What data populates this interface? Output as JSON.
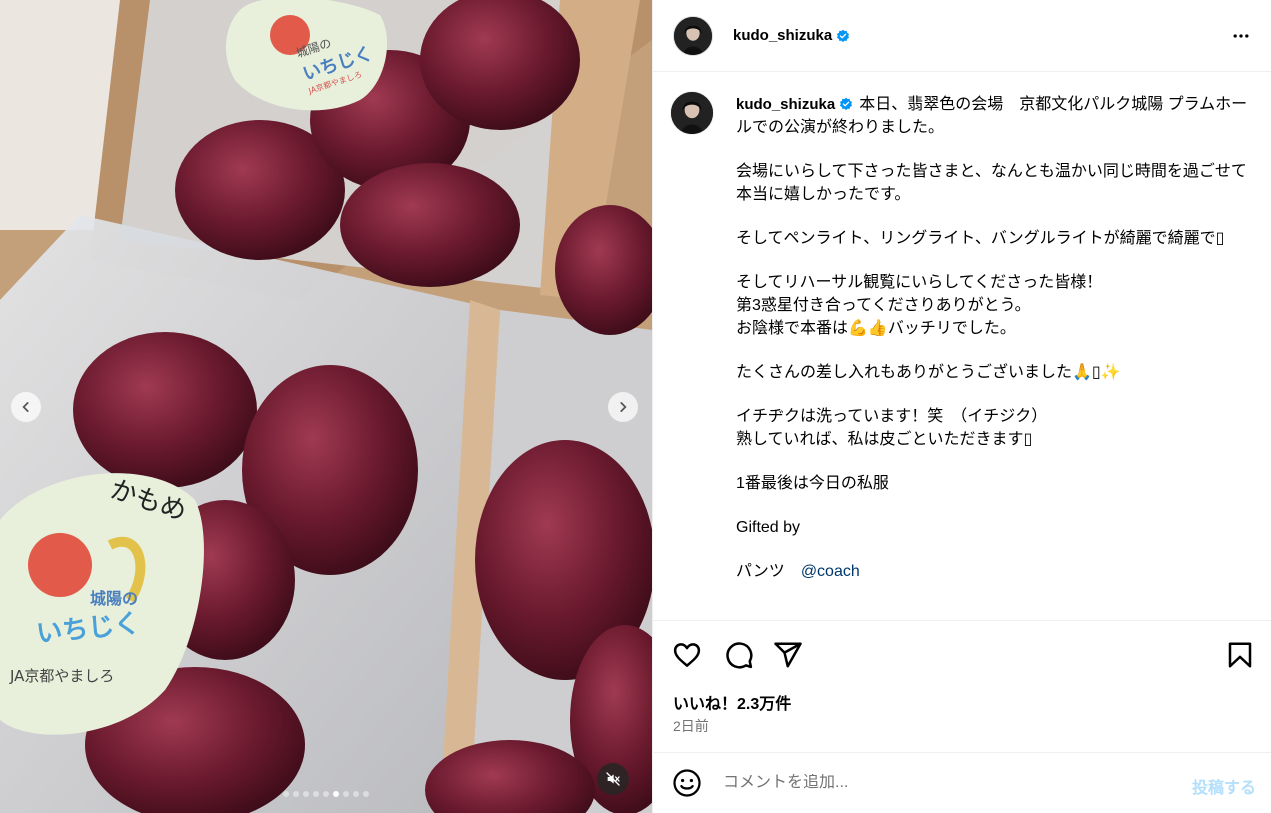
{
  "post": {
    "username": "kudo_shizuka",
    "verified_icon": "verified-badge-icon",
    "more_icon": "more-options-icon"
  },
  "media": {
    "label_top": {
      "line1": "城陽の",
      "line2": "いちじく",
      "line3": "JA京都やましろ"
    },
    "label_bottom": {
      "handwritten": "かもめ",
      "line1": "城陽の",
      "line2": "いちじく",
      "line3": "JA京都やましろ"
    },
    "slide_count": 9,
    "active_slide": 6,
    "colors": {
      "fig": "#6b1a2e",
      "box": "#c9a57d",
      "tray": "#d9dde3",
      "label": "#e8f0dc"
    }
  },
  "caption": {
    "lines": [
      {
        "text": "本日、翡翠色の会場　京都文化パルク城陽 プラムホールでの公演が終わりました。"
      },
      {
        "text": "会場にいらして下さった皆さまと、なんとも温かい同じ時間を過ごせて本当に嬉しかったです。"
      },
      {
        "text": "そしてペンライト、リングライト、バングルライトが綺麗で綺麗で▯"
      },
      {
        "text": "そしてリハーサル観覧にいらしてくださった皆様！"
      },
      {
        "text": "第3惑星付き合ってくださりありがとう。"
      },
      {
        "text": "お陰様で本番は💪👍バッチリでした。"
      },
      {
        "text": "たくさんの差し入れもありがとうございました🙏▯✨"
      },
      {
        "text": "イチヂクは洗っています！笑　（イチジク）"
      },
      {
        "text": "熟していれば、私は皮ごといただきます▯"
      },
      {
        "text": "1番最後は今日の私服"
      },
      {
        "text": "Gifted by"
      },
      {
        "text": "パンツ　"
      }
    ],
    "mention": "@coach"
  },
  "stats": {
    "likes": "いいね！2.3万件",
    "time": "2日前"
  },
  "comment": {
    "placeholder": "コメントを追加...",
    "post_label": "投稿する"
  }
}
